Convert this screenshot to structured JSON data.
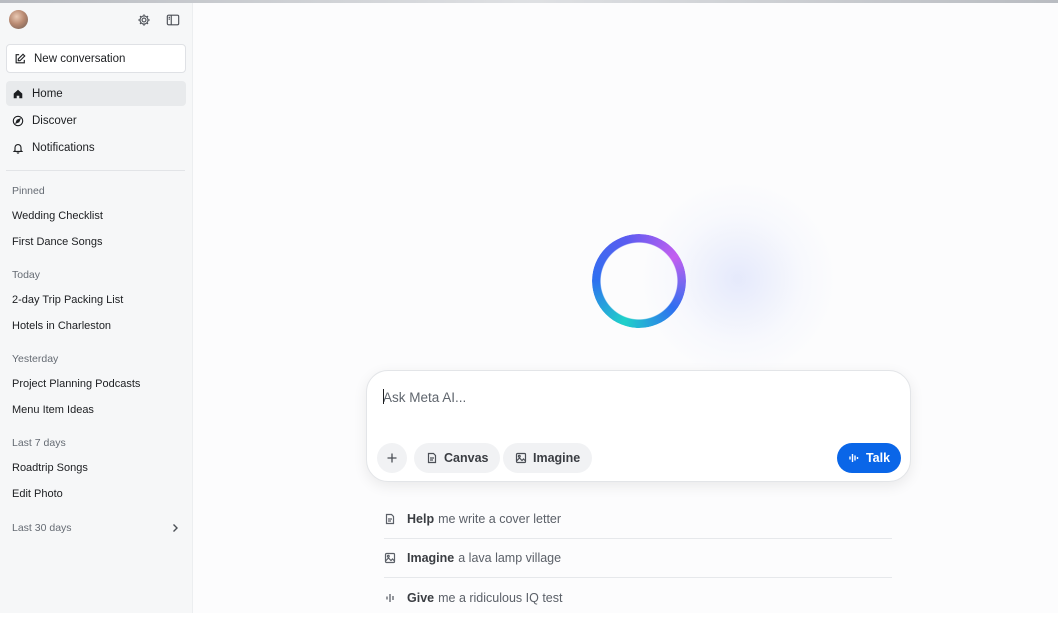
{
  "sidebar": {
    "new_conversation": "New conversation",
    "nav": [
      {
        "label": "Home",
        "icon": "home-icon",
        "active": true
      },
      {
        "label": "Discover",
        "icon": "compass-icon",
        "active": false
      },
      {
        "label": "Notifications",
        "icon": "bell-icon",
        "active": false
      }
    ],
    "sections": {
      "pinned": {
        "label": "Pinned",
        "items": [
          "Wedding Checklist",
          "First Dance Songs"
        ]
      },
      "today": {
        "label": "Today",
        "items": [
          "2-day Trip Packing List",
          "Hotels in Charleston"
        ]
      },
      "yesterday": {
        "label": "Yesterday",
        "items": [
          "Project Planning Podcasts",
          "Menu Item Ideas"
        ]
      },
      "last7": {
        "label": "Last 7 days",
        "items": [
          "Roadtrip Songs",
          "Edit Photo"
        ]
      }
    },
    "last30_label": "Last 30 days"
  },
  "composer": {
    "placeholder": "Ask Meta AI...",
    "canvas_label": "Canvas",
    "imagine_label": "Imagine",
    "talk_label": "Talk"
  },
  "suggestions": [
    {
      "bold": "Help",
      "rest": "me write a cover letter",
      "icon": "document-icon"
    },
    {
      "bold": "Imagine",
      "rest": "a lava lamp village",
      "icon": "image-icon"
    },
    {
      "bold": "Give",
      "rest": "me a ridiculous IQ test",
      "icon": "waveform-icon"
    }
  ],
  "colors": {
    "accent": "#0a66e8",
    "sidebar_bg": "#f6f7f8",
    "active_item_bg": "#e8eaec"
  }
}
